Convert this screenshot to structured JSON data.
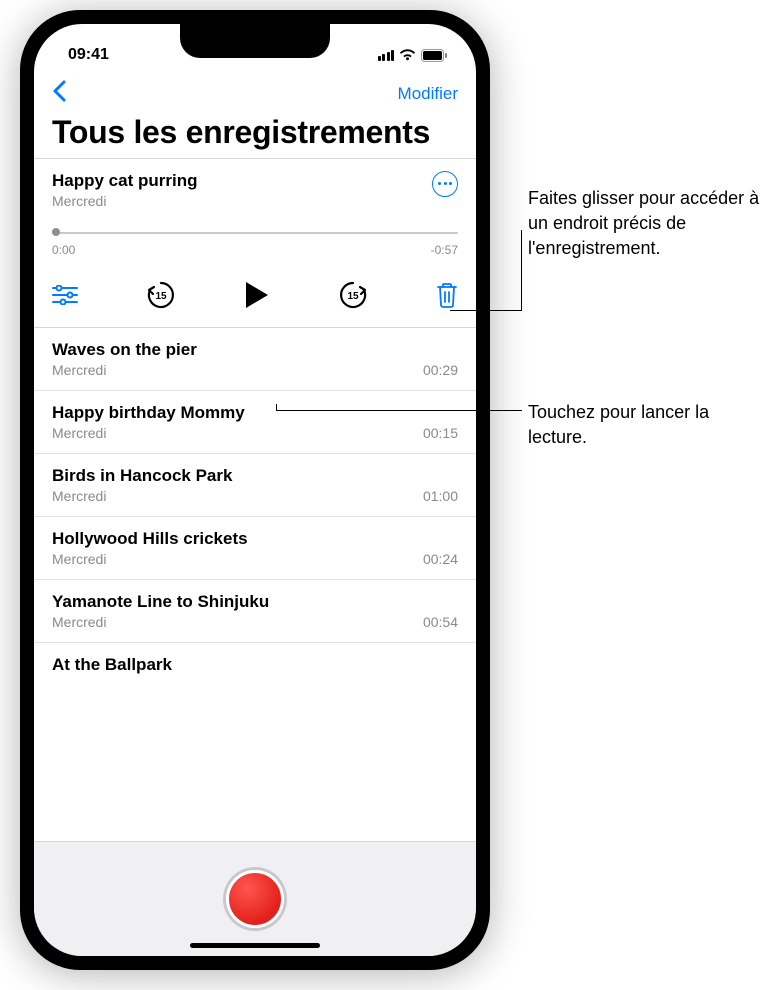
{
  "status": {
    "time": "09:41"
  },
  "nav": {
    "edit_label": "Modifier"
  },
  "page_title": "Tous les enregistrements",
  "expanded": {
    "title": "Happy cat purring",
    "subtitle": "Mercredi",
    "time_start": "0:00",
    "time_end": "-0:57",
    "skip_seconds": "15"
  },
  "recordings": [
    {
      "title": "Waves on the pier",
      "subtitle": "Mercredi",
      "duration": "00:29"
    },
    {
      "title": "Happy birthday Mommy",
      "subtitle": "Mercredi",
      "duration": "00:15"
    },
    {
      "title": "Birds in Hancock Park",
      "subtitle": "Mercredi",
      "duration": "01:00"
    },
    {
      "title": "Hollywood Hills crickets",
      "subtitle": "Mercredi",
      "duration": "00:24"
    },
    {
      "title": "Yamanote Line to Shinjuku",
      "subtitle": "Mercredi",
      "duration": "00:54"
    },
    {
      "title": "At the Ballpark",
      "subtitle": "",
      "duration": ""
    }
  ],
  "callouts": {
    "scrub": "Faites glisser pour accéder à un endroit précis de l'enregistrement.",
    "play": "Touchez pour lancer la lecture."
  }
}
